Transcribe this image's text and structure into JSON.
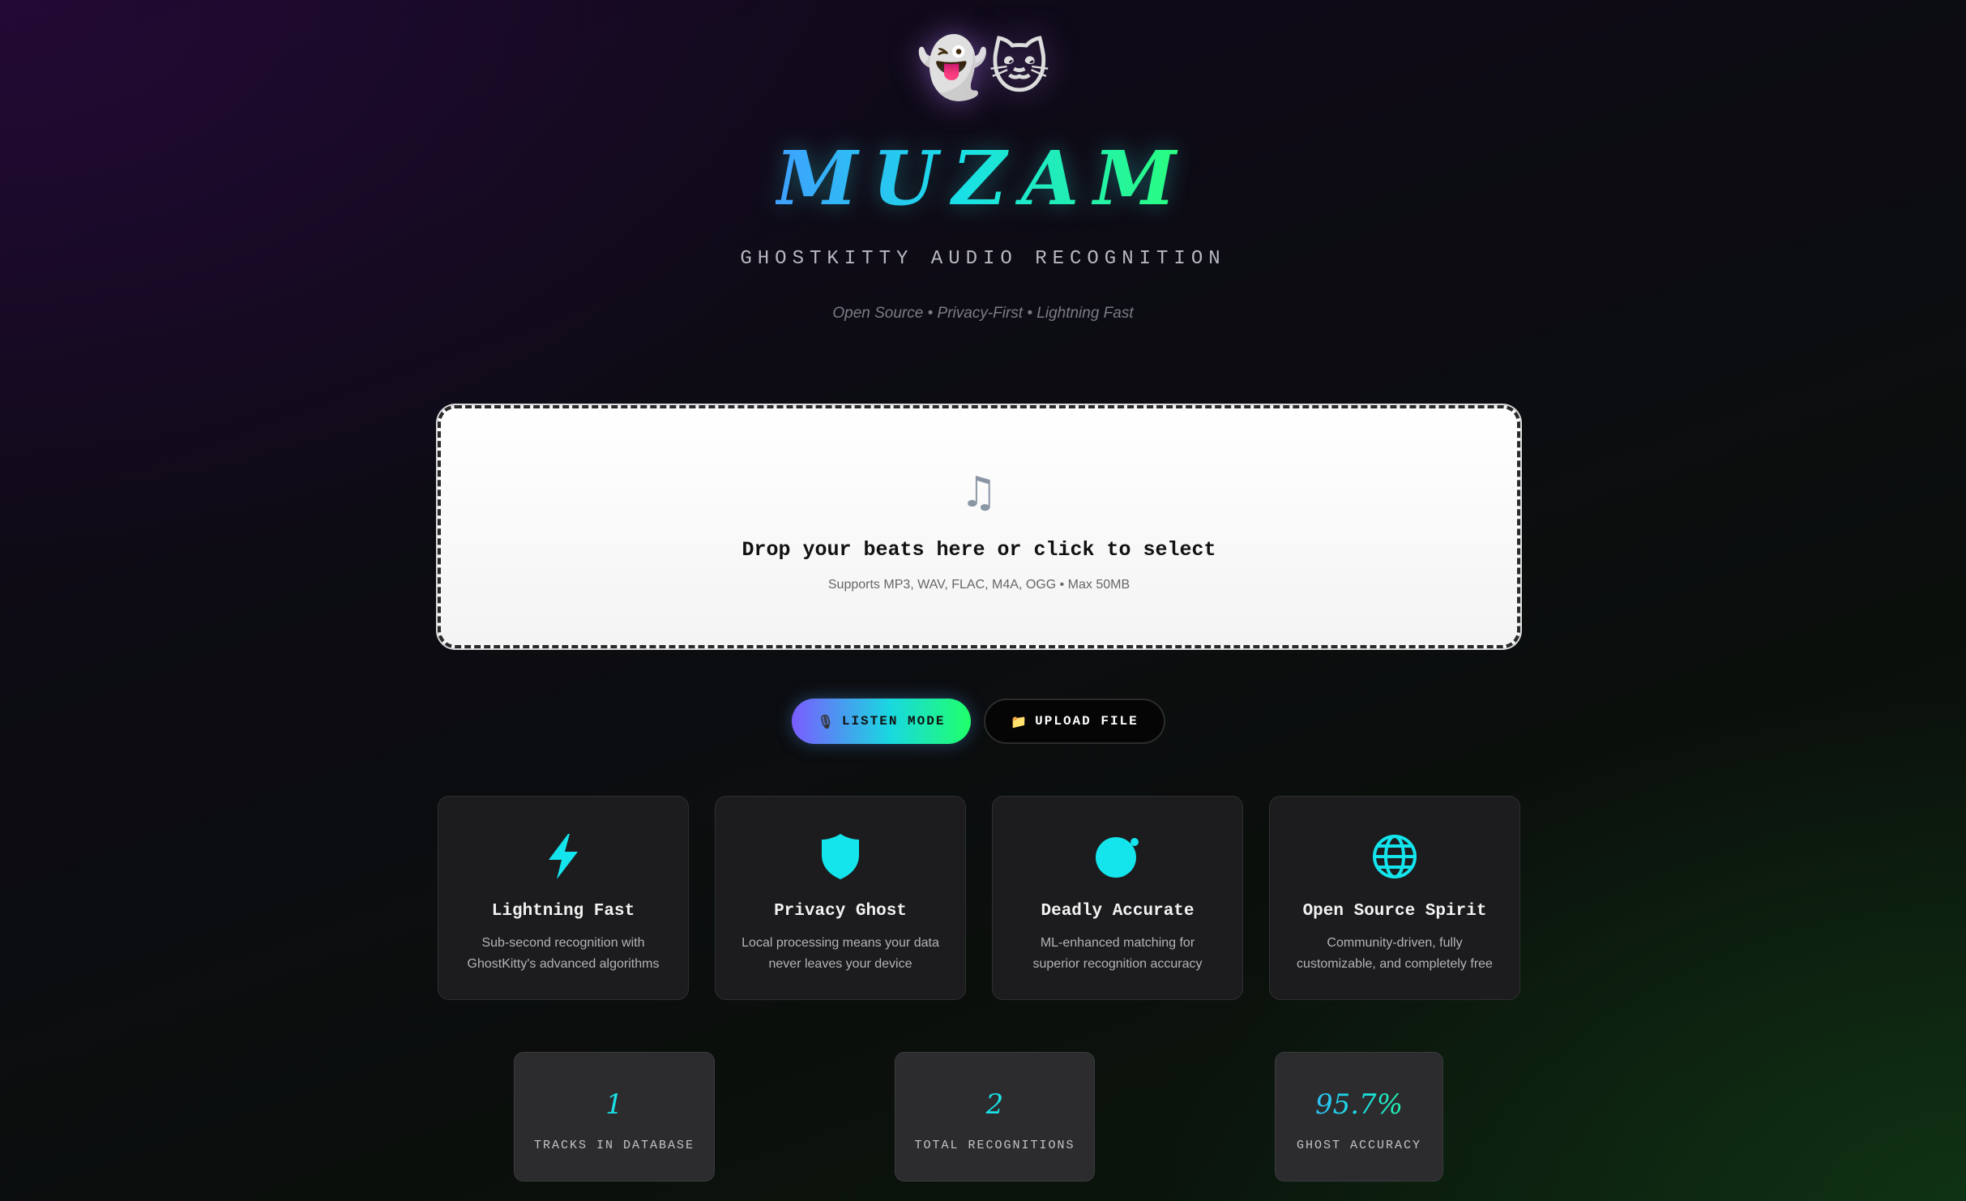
{
  "header": {
    "mascot_ghost": "👻",
    "mascot_cat": "🐱",
    "title": "MUZAM",
    "subtitle": "GHOSTKITTY AUDIO RECOGNITION",
    "tagline": "Open Source • Privacy-First • Lightning Fast"
  },
  "dropzone": {
    "icon": "music-note-icon",
    "icon_glyph": "♫",
    "title": "Drop your beats here or click to select",
    "subtitle": "Supports MP3, WAV, FLAC, M4A, OGG • Max 50MB"
  },
  "actions": {
    "listen": {
      "icon": "microphone-icon",
      "glyph": "🎙",
      "label": "LISTEN MODE"
    },
    "upload": {
      "icon": "folder-icon",
      "glyph": "📁",
      "label": "UPLOAD FILE"
    }
  },
  "features": [
    {
      "icon": "lightning-icon",
      "title": "Lightning Fast",
      "description": "Sub-second recognition with GhostKitty's advanced algorithms"
    },
    {
      "icon": "shield-icon",
      "title": "Privacy Ghost",
      "description": "Local processing means your data never leaves your device"
    },
    {
      "icon": "target-icon",
      "title": "Deadly Accurate",
      "description": "ML-enhanced matching for superior recognition accuracy"
    },
    {
      "icon": "globe-icon",
      "title": "Open Source Spirit",
      "description": "Community-driven, fully customizable, and completely free"
    }
  ],
  "stats": [
    {
      "value": "1",
      "label": "TRACKS IN DATABASE"
    },
    {
      "value": "2",
      "label": "TOTAL RECOGNITIONS"
    },
    {
      "value": "95.7%",
      "label": "GHOST ACCURACY"
    }
  ],
  "colors": {
    "accent_cyan": "#19e0e6",
    "accent_green": "#2bff7a",
    "accent_blue": "#3fa0ff",
    "accent_purple": "#7a5cff",
    "card_bg": "#1c1c1e"
  }
}
